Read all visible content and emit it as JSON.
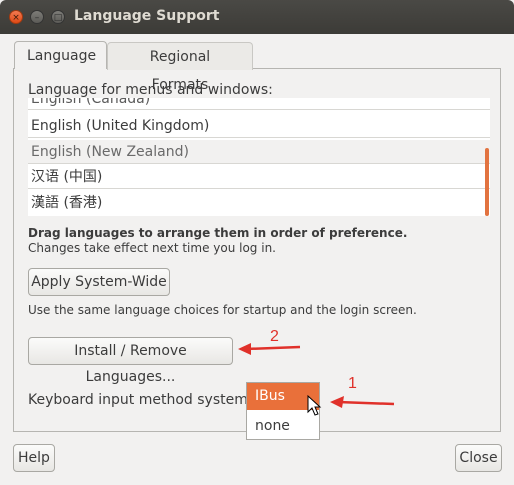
{
  "window": {
    "title": "Language Support",
    "close_icon": "×",
    "min_icon": "–",
    "max_icon": "□"
  },
  "tabs": [
    {
      "label": "Language",
      "active": true
    },
    {
      "label": "Regional Formats",
      "active": false
    }
  ],
  "language_section": {
    "heading": "Language for menus and windows:",
    "items": [
      "English (Canada)",
      "English (United Kingdom)",
      "English (New Zealand)",
      "汉语 (中国)",
      "漢語 (香港)"
    ],
    "hint_bold": "Drag languages to arrange them in order of preference.",
    "hint": "Changes take effect next time you log in."
  },
  "apply_button": "Apply System-Wide",
  "apply_note": "Use the same language choices for startup and the login screen.",
  "install_button": "Install / Remove Languages...",
  "keyboard": {
    "label": "Keyboard input method system:",
    "options": [
      "IBus",
      "none"
    ],
    "selected": "IBus"
  },
  "footer": {
    "help": "Help",
    "close": "Close"
  },
  "annotations": {
    "marker_1": "1",
    "marker_2": "2",
    "color": "#e0312a"
  },
  "colors": {
    "accent": "#e9703a",
    "titlebar": "#3c3b37"
  }
}
